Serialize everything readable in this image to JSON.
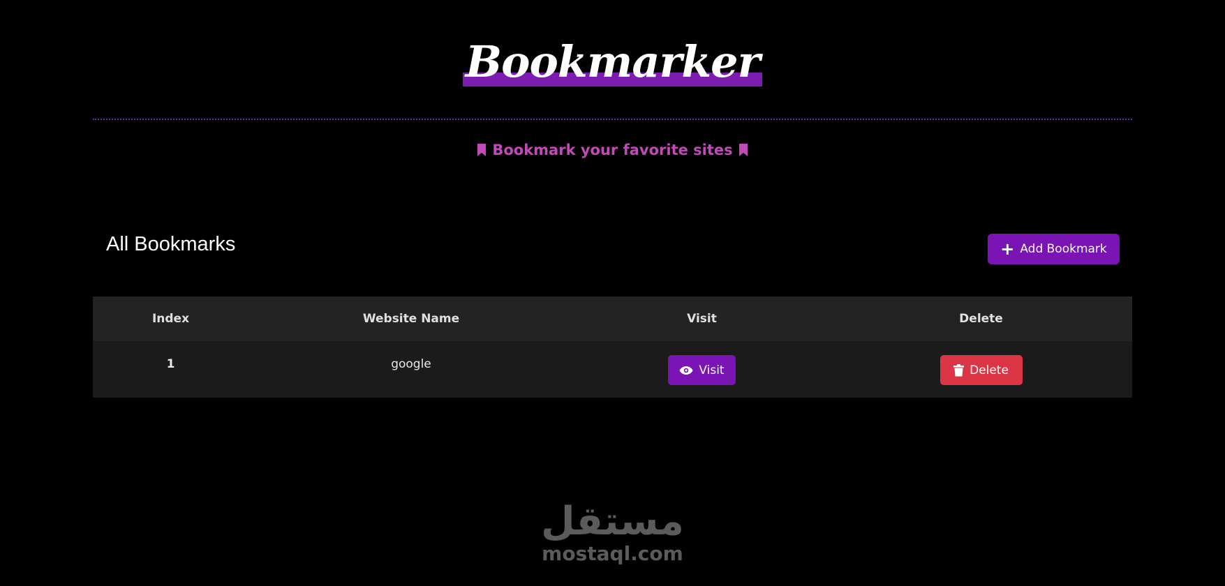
{
  "header": {
    "title": "Bookmarker",
    "tagline": "Bookmark your favorite sites"
  },
  "section": {
    "title": "All Bookmarks",
    "add_button_label": "Add Bookmark"
  },
  "table": {
    "columns": [
      "Index",
      "Website Name",
      "Visit",
      "Delete"
    ],
    "rows": [
      {
        "index": "1",
        "name": "google",
        "visit_label": "Visit",
        "delete_label": "Delete"
      }
    ]
  },
  "watermark": {
    "arabic": "مستقل",
    "latin": "mostaql.com"
  },
  "colors": {
    "accent_purple": "#7a14b4",
    "tagline_pink": "#c04bb8",
    "delete_red": "#dc3545",
    "background": "#000000"
  },
  "icons": {
    "tagline": "bookmark-icon",
    "add": "plus-icon",
    "visit": "eye-icon",
    "delete": "trash-icon"
  }
}
